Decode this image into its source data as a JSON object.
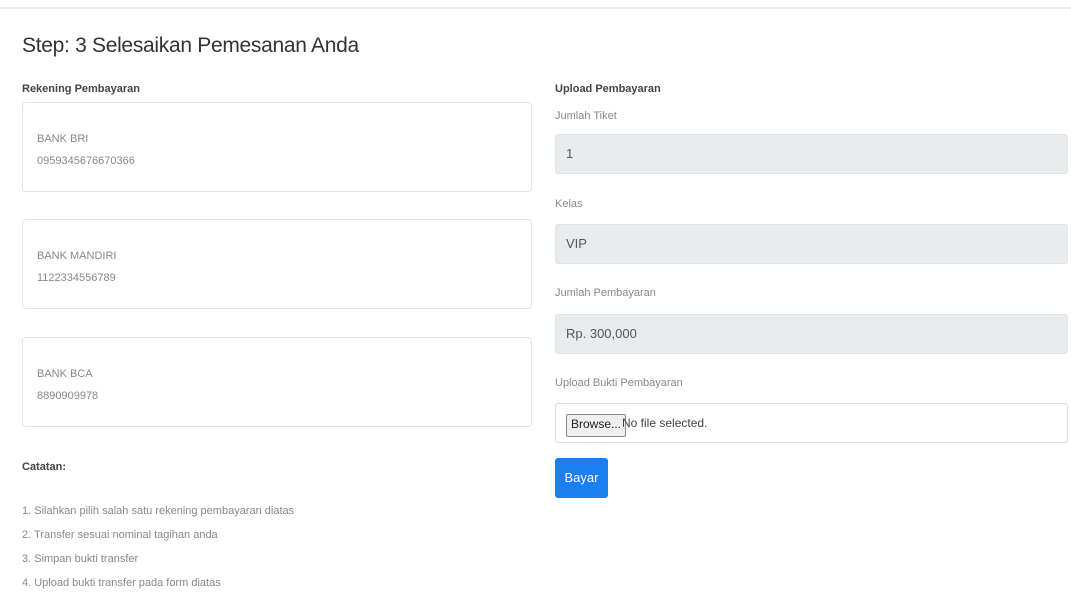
{
  "page": {
    "title": "Step: 3 Selesaikan Pemesanan Anda"
  },
  "payment_accounts": {
    "label": "Rekening Pembayaran",
    "banks": [
      {
        "name": "BANK BRI",
        "number": "0959345676670366"
      },
      {
        "name": "BANK MANDIRI",
        "number": "1122334556789"
      },
      {
        "name": "BANK BCA",
        "number": "8890909978"
      }
    ]
  },
  "notes": {
    "label": "Catatan:",
    "items": [
      "1. Silahkan pilih salah satu rekening pembayaran diatas",
      "2. Transfer sesuai nominal tagihan anda",
      "3. Simpan bukti transfer",
      "4. Upload bukti transfer pada form diatas"
    ]
  },
  "upload": {
    "label": "Upload Pembayaran",
    "ticket_count": {
      "label": "Jumlah Tiket",
      "value": "1"
    },
    "class": {
      "label": "Kelas",
      "value": "VIP"
    },
    "payment_amount": {
      "label": "Jumlah Pembayaran",
      "value": "Rp. 300,000"
    },
    "proof": {
      "label": "Upload Bukti Pembayaran",
      "browse_label": "Browse...",
      "status": "No file selected."
    },
    "submit_label": "Bayar"
  },
  "colors": {
    "accent": "#1a7ff0",
    "readonly_bg": "#e9ecef"
  }
}
